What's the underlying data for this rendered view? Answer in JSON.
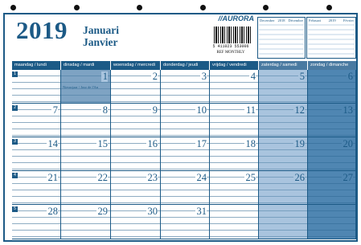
{
  "year": "2019",
  "month_nl": "Januari",
  "month_fr": "Janvier",
  "brand": "//AURORA",
  "barcode_number": "5 411023 553006",
  "reference": "REF MONTHLY",
  "mini_calendars": [
    {
      "title_left": "December",
      "title_mid": "2018",
      "title_right": "Décembre"
    },
    {
      "title_left": "Februari",
      "title_mid": "2019",
      "title_right": "Février"
    }
  ],
  "day_headers": [
    "maandag / lundi",
    "dinsdag / mardi",
    "woensdag / mercredi",
    "donderdag / jeudi",
    "vrijdag / vendredi",
    "zaterdag / samedi",
    "zondag / dimanche"
  ],
  "weeks": [
    {
      "week": "1",
      "days": [
        "",
        "1",
        "2",
        "3",
        "4",
        "5",
        "6"
      ]
    },
    {
      "week": "2",
      "days": [
        "7",
        "8",
        "9",
        "10",
        "11",
        "12",
        "13"
      ]
    },
    {
      "week": "3",
      "days": [
        "14",
        "15",
        "16",
        "17",
        "18",
        "19",
        "20"
      ]
    },
    {
      "week": "4",
      "days": [
        "21",
        "22",
        "23",
        "24",
        "25",
        "26",
        "27"
      ]
    },
    {
      "week": "5",
      "days": [
        "28",
        "29",
        "30",
        "31",
        "",
        "",
        ""
      ]
    }
  ],
  "holiday_note": "Nieuwjaar / Jour de l'An",
  "colors": {
    "primary": "#1c5a86",
    "saturday": "#a9c4de",
    "sunday": "#4f86b2"
  }
}
